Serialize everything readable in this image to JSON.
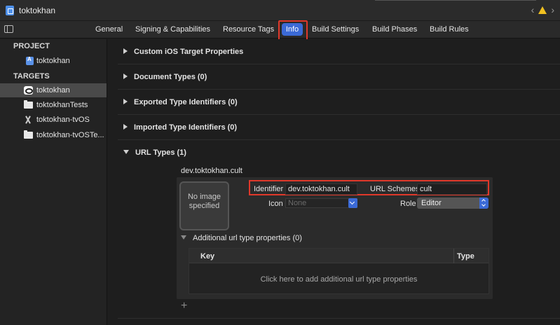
{
  "window": {
    "title": "toktokhan"
  },
  "tabs": [
    {
      "label": "General"
    },
    {
      "label": "Signing & Capabilities"
    },
    {
      "label": "Resource Tags"
    },
    {
      "label": "Info",
      "selected": true
    },
    {
      "label": "Build Settings"
    },
    {
      "label": "Build Phases"
    },
    {
      "label": "Build Rules"
    }
  ],
  "sidebar": {
    "project_header": "PROJECT",
    "project_items": [
      {
        "label": "toktokhan",
        "icon": "project-file-icon"
      }
    ],
    "targets_header": "TARGETS",
    "target_items": [
      {
        "label": "toktokhan",
        "icon": "app-target-icon",
        "selected": true
      },
      {
        "label": "toktokhanTests",
        "icon": "test-bundle-icon"
      },
      {
        "label": "toktokhan-tvOS",
        "icon": "tvos-app-icon"
      },
      {
        "label": "toktokhan-tvOSTe...",
        "icon": "test-bundle-icon"
      }
    ]
  },
  "sections": [
    {
      "label": "Custom iOS Target Properties",
      "expanded": false
    },
    {
      "label": "Document Types (0)",
      "expanded": false
    },
    {
      "label": "Exported Type Identifiers (0)",
      "expanded": false
    },
    {
      "label": "Imported Type Identifiers (0)",
      "expanded": false
    },
    {
      "label": "URL Types (1)",
      "expanded": true
    }
  ],
  "url_type": {
    "name": "dev.toktokhan.cult",
    "image_placeholder": "No image specified",
    "identifier_label": "Identifier",
    "identifier_value": "dev.toktokhan.cult",
    "url_schemes_label": "URL Schemes",
    "url_schemes_value": "cult",
    "icon_label": "Icon",
    "icon_placeholder": "None",
    "role_label": "Role",
    "role_value": "Editor",
    "additional_props_label": "Additional url type properties (0)",
    "table_columns": [
      "Key",
      "Type"
    ],
    "table_empty_text": "Click here to add additional url type properties",
    "add_button": "+"
  },
  "colors": {
    "accent": "#3b6ad6",
    "highlight_red": "#e0382a",
    "background": "#1e1e1e"
  }
}
